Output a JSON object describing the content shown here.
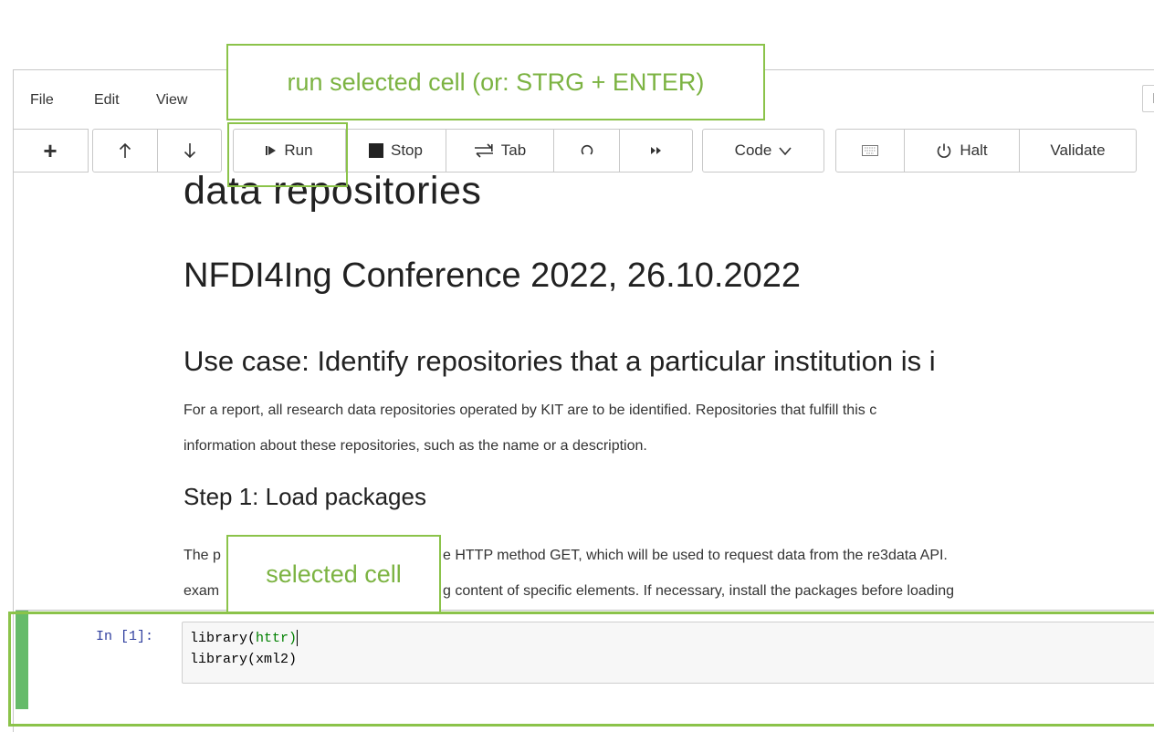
{
  "menubar": {
    "items": [
      "File",
      "Edit",
      "View"
    ],
    "right_partial": "Ke"
  },
  "toolbar": {
    "add_label": "+",
    "run_label": "Run",
    "stop_label": "Stop",
    "tab_label": "Tab",
    "cell_type": "Code",
    "halt_label": "Halt",
    "validate_label": "Validate"
  },
  "notebook": {
    "title_partial": "data repositories",
    "subtitle": "NFDI4Ing Conference 2022, 26.10.2022",
    "use_case_heading": "Use case: Identify repositories that a particular institution is i",
    "use_case_text_1": "For a report, all research data repositories operated by KIT are to be identified. Repositories that fulfill this c",
    "use_case_text_2": "information about these repositories, such as the name or a description.",
    "step1_heading": "Step 1: Load packages",
    "step1_text_1_left": "The p",
    "step1_text_1_right": "e HTTP method GET, which will be used to request data from the re3data API.",
    "step1_text_2_left": "exam",
    "step1_text_2_right": "g content of specific elements. If necessary, install the packages before loading"
  },
  "cell": {
    "prompt": "In [1]:",
    "line1_fn": "library(",
    "line1_pkg": "httr",
    "line1_close": ")",
    "line2": "library(xml2)"
  },
  "annotations": {
    "run_note": "run selected cell (or: STRG + ENTER)",
    "cell_note": "selected cell"
  },
  "colors": {
    "annotation": "#8bc34a",
    "selected_bar": "#66bb6a"
  }
}
